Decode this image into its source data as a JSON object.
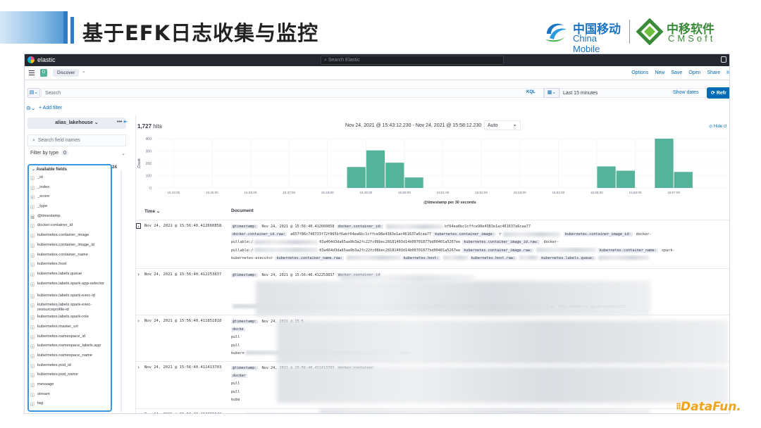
{
  "slide": {
    "title": "基于EFK日志收集与监控",
    "logo_cm_cn": "中国移动",
    "logo_cm_en": "China Mobile",
    "logo_cs_cn": "中移软件",
    "logo_cs_en": "CMSoft",
    "datafun": "DataFun."
  },
  "topbar": {
    "brand": "elastic",
    "search_placeholder": "Search Elastic"
  },
  "nav": {
    "space_letter": "D",
    "app": "Discover",
    "links": [
      "Options",
      "New",
      "Save",
      "Open",
      "Share",
      "In"
    ]
  },
  "query": {
    "placeholder": "Search",
    "kql": "KQL",
    "time_range": "Last 15 minutes",
    "show_dates": "Show dates",
    "refresh": "Refr"
  },
  "filter": {
    "add": "+ Add filter"
  },
  "sidebar": {
    "index_pattern": "alias_lakehouse",
    "search_placeholder": "Search field names",
    "filter_by_type": "Filter by type",
    "filter_count": "0",
    "available_label": "Available fields",
    "available_count": "24",
    "fields": [
      {
        "type": "t",
        "name": "_id"
      },
      {
        "type": "t",
        "name": "_index"
      },
      {
        "type": "#",
        "name": "_score"
      },
      {
        "type": "t",
        "name": "_type"
      },
      {
        "type": "▤",
        "name": "@timestamp"
      },
      {
        "type": "t",
        "name": "docker.container_id"
      },
      {
        "type": "t",
        "name": "kubernetes.container_image"
      },
      {
        "type": "t",
        "name": "kubernetes.container_image_id"
      },
      {
        "type": "t",
        "name": "kubernetes.container_name"
      },
      {
        "type": "t",
        "name": "kubernetes.host"
      },
      {
        "type": "t",
        "name": "kubernetes.labels.queue"
      },
      {
        "type": "t",
        "name": "kubernetes.labels.spark-app-selector",
        "two": true
      },
      {
        "type": "t",
        "name": "kubernetes.labels.spark-exec-id"
      },
      {
        "type": "t",
        "name": "kubernetes.labels.spark-exec-resourceprofile-id",
        "two": true
      },
      {
        "type": "t",
        "name": "kubernetes.labels.spark-role"
      },
      {
        "type": "t",
        "name": "kubernetes.master_url"
      },
      {
        "type": "t",
        "name": "kubernetes.namespace_id"
      },
      {
        "type": "t",
        "name": "kubernetes.namespace_labels.app"
      },
      {
        "type": "t",
        "name": "kubernetes.namespace_name"
      },
      {
        "type": "t",
        "name": "kubernetes.pod_id"
      },
      {
        "type": "t",
        "name": "kubernetes.pod_name"
      },
      {
        "type": "t",
        "name": "message"
      },
      {
        "type": "t",
        "name": "stream"
      },
      {
        "type": "t",
        "name": "tag"
      }
    ]
  },
  "main": {
    "hits_count": "1,727",
    "hits_label": "hits",
    "range": "Nov 24, 2021 @ 15:43:12.230 - Nov 24, 2021 @ 15:58:12.230",
    "interval": "Auto",
    "hide_chart": "Hide cl",
    "col_time": "Time ⌄",
    "col_doc": "Document"
  },
  "chart_data": {
    "type": "bar",
    "xlabel": "@timestamp per 30 seconds",
    "ylabel": "Count",
    "ylim": [
      0,
      400
    ],
    "yticks": [
      0,
      100,
      200,
      300,
      400
    ],
    "x_ticks": [
      "15:44:00",
      "15:45:00",
      "15:46:00",
      "15:47:00",
      "15:48:00",
      "15:49:00",
      "15:50:00",
      "15:51:00",
      "15:52:00",
      "15:53:00",
      "15:54:00",
      "15:55:00",
      "15:56:00",
      "15:57:00"
    ],
    "categories": [
      "15:48:30",
      "15:49:00",
      "15:49:30",
      "15:50:00",
      "15:55:00",
      "15:55:30",
      "15:56:30",
      "15:57:00"
    ],
    "values": [
      170,
      305,
      205,
      85,
      175,
      140,
      450,
      130
    ],
    "color": "#54b399"
  },
  "rows": [
    {
      "time": "Nov 24, 2021 @ 15:56:40.412660858",
      "lines": [
        [
          {
            "k": "@timestamp:"
          },
          {
            "v": " Nov 24, 2021 @ 15:56:40.412660858 "
          },
          {
            "k": "docker.container_id:"
          },
          {
            "b": 90
          },
          {
            "v": "bf64ea6bc1cffce98e4383e1ac461637a6caa77"
          }
        ],
        [
          {
            "k": "docker.container_id.raw:"
          },
          {
            "v": " a657f86c740733f72f865bf6abf64ea6bc1cffce98e4383e1ac461637a6caa77 "
          },
          {
            "k": "kubernetes.container_image:"
          },
          {
            "v": " r"
          },
          {
            "b": 90
          },
          {
            "v": " "
          },
          {
            "k": "kubernetes.container_image_id:"
          },
          {
            "v": " docker-"
          }
        ],
        [
          {
            "v": "pullable:/"
          },
          {
            "b": 100
          },
          {
            "v": "03a464d3da65aa9b3a2fc22fc08bec28181403d14b00701877bd00401a5267ee "
          },
          {
            "k": "kubernetes.container_image_id.raw:"
          },
          {
            "v": " docker-"
          }
        ],
        [
          {
            "v": "pullable:/"
          },
          {
            "b": 100
          },
          {
            "v": "03a464d3da65aa9b3a2fc22fc08bec28181403d14b00701877bd00401a5267ee "
          },
          {
            "k": "kubernetes.container_image.raw:"
          },
          {
            "b": 95
          },
          {
            "k": "kubernetes.container_name:"
          },
          {
            "v": " spark-"
          }
        ],
        [
          {
            "v": "kubernetes-executor "
          },
          {
            "k": "kubernetes.container_name.raw:"
          },
          {
            "b": 85
          },
          {
            "k": "kubernetes.host:"
          },
          {
            "b": 40
          },
          {
            "k": "kubernetes.host.raw:"
          },
          {
            "b": 30
          },
          {
            "k": "kubernetes.labels.queue:"
          },
          {
            "b": 80
          }
        ]
      ]
    },
    {
      "time": "Nov 24, 2021 @ 15:56:40.412253837",
      "lines": [
        [
          {
            "k": "@timestamp:"
          },
          {
            "v": " Nov 24, 2021 @ 15:56:40.412253837 "
          },
          {
            "k": "docker.container_id"
          }
        ],
        [],
        [],
        [],
        [
          {
            "b": 500
          },
          {
            "v": "e: root.lakehouse-guchangsheng1020"
          }
        ]
      ]
    },
    {
      "time": "Nov 24, 2021 @ 15:56:40.411851818",
      "lines": [
        [
          {
            "k": "@timestamp:"
          },
          {
            "v": " Nov 24, 2021 @ 15:5"
          }
        ],
        [
          {
            "k": "docke"
          }
        ],
        [
          {
            "v": "pull"
          }
        ],
        [
          {
            "v": "pull"
          }
        ],
        [
          {
            "v": "kubern"
          },
          {
            "b": 230
          },
          {
            "v": "...netes.r"
          }
        ]
      ]
    },
    {
      "time": "Nov 24, 2021 @ 15:56:40.411413703",
      "lines": [
        [
          {
            "k": "@timestamp:"
          },
          {
            "v": " Nov 24, 2021 @ 15:56:40.411413703 "
          },
          {
            "k": "docker.container"
          }
        ],
        [
          {
            "k": "docker"
          }
        ],
        [
          {
            "v": "pull"
          }
        ],
        [
          {
            "v": "pull"
          }
        ],
        [
          {
            "v": "kube"
          }
        ]
      ]
    },
    {
      "time": "Nov 24, 2021 @ 15:56:40.410955540",
      "lines": [
        [
          {
            "k": "@tim"
          },
          {
            "b": 380
          },
          {
            "v": "...ecks/)"
          }
        ]
      ]
    }
  ]
}
